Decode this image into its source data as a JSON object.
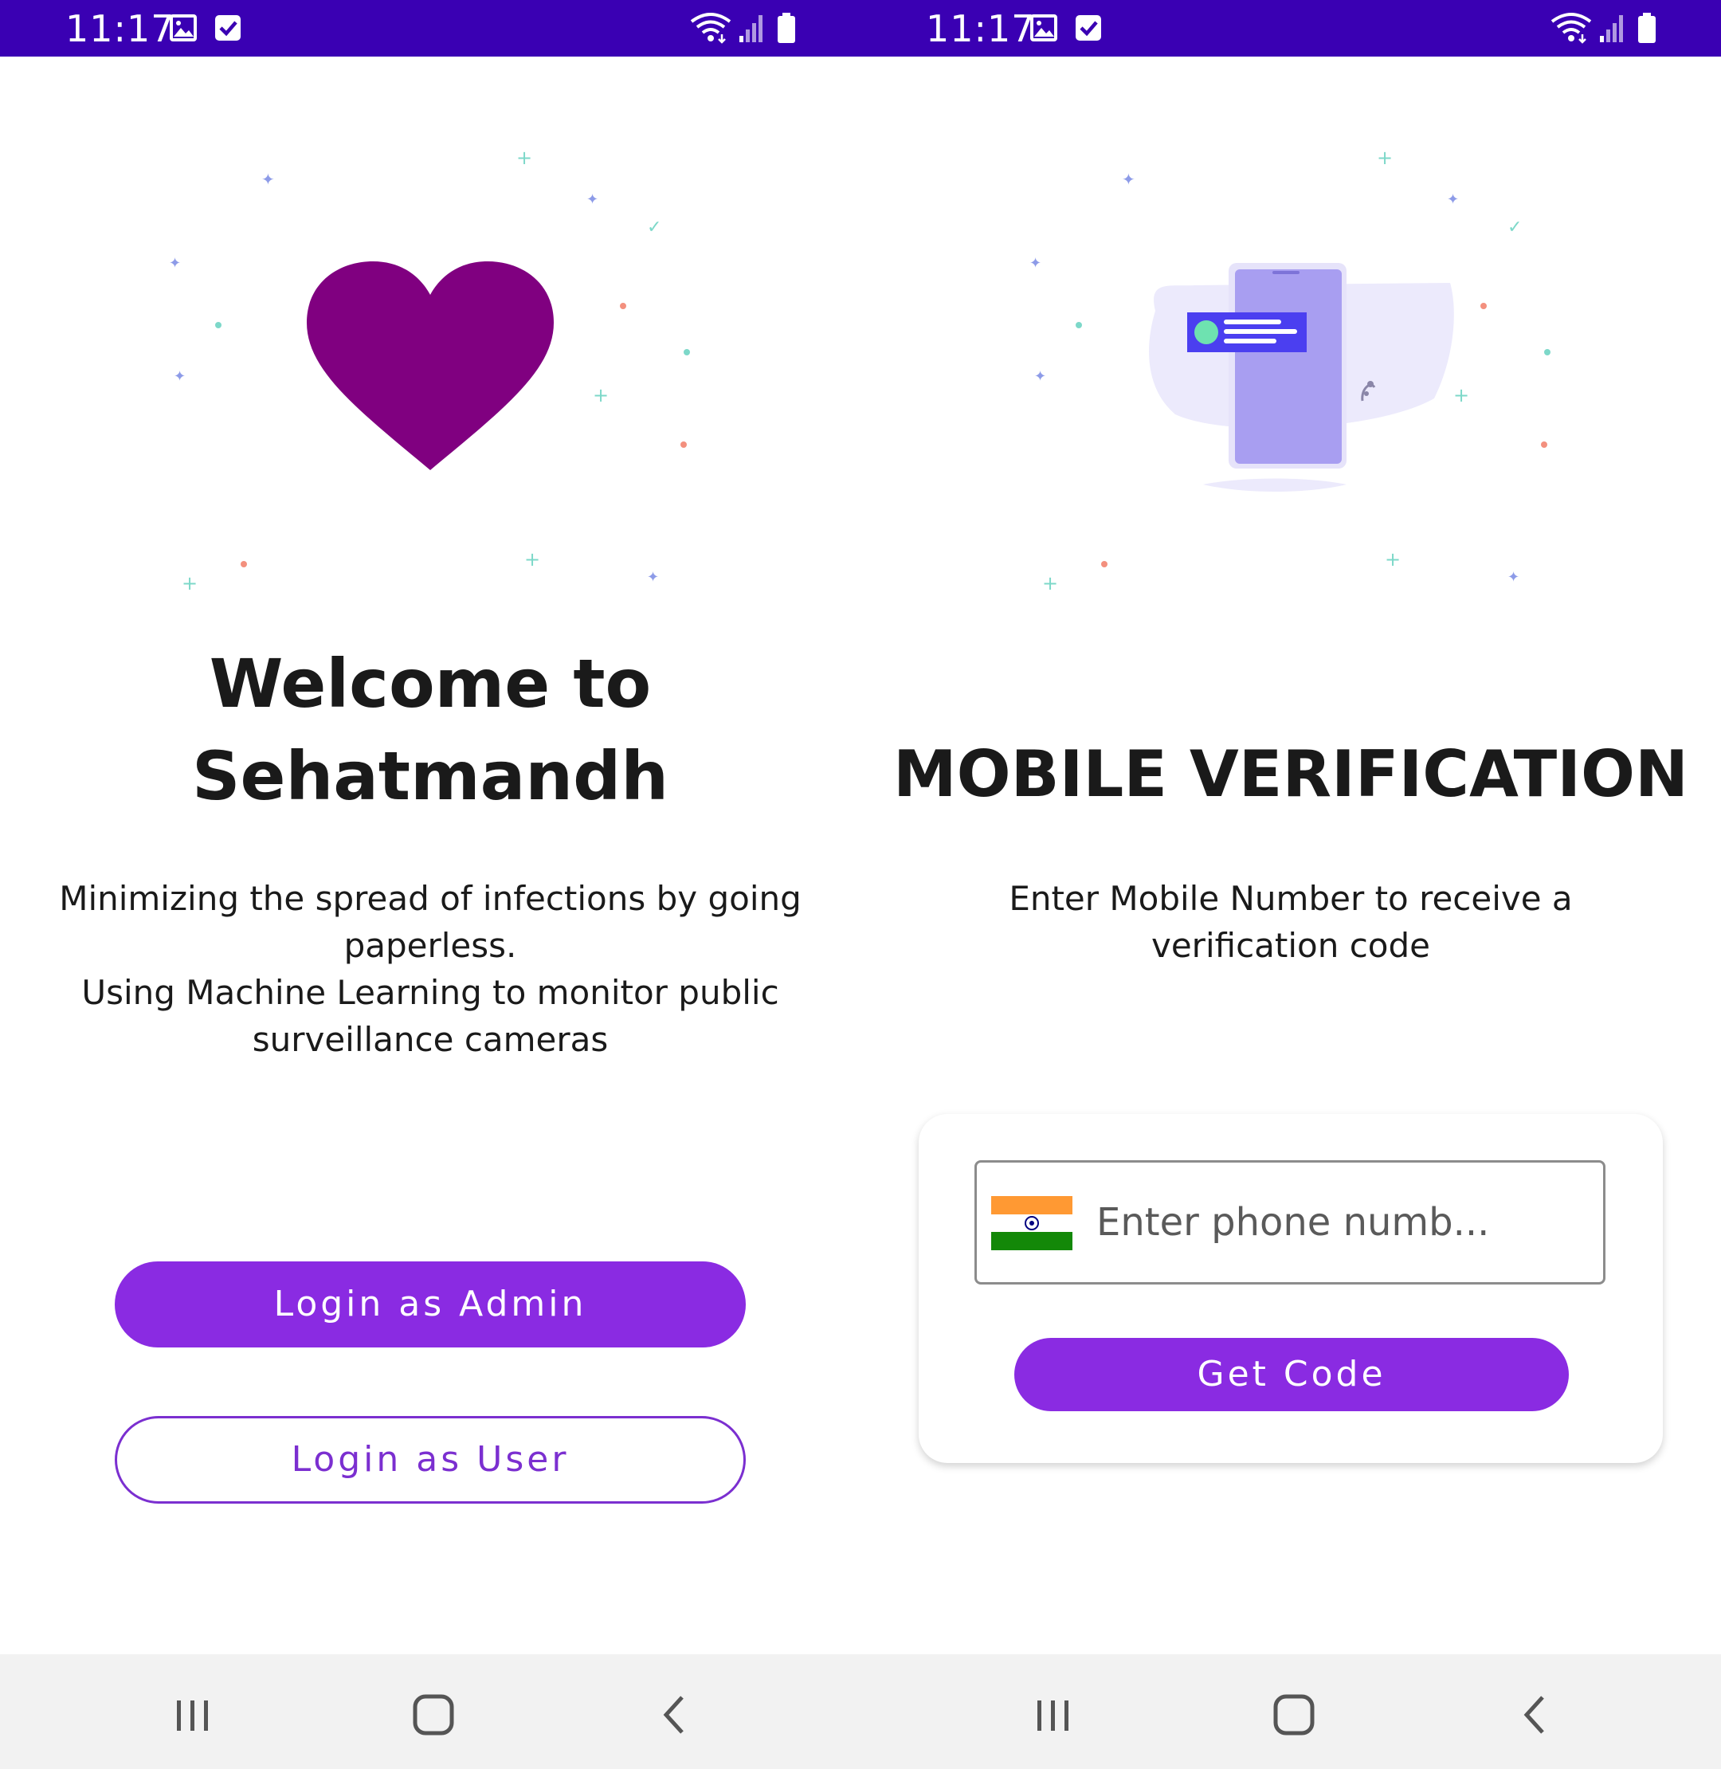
{
  "status_bar": {
    "time": "11:17"
  },
  "welcome_screen": {
    "title_line1": "Welcome to",
    "title_line2": "Sehatmandh",
    "description_line1": "Minimizing the spread of infections by going",
    "description_line2": "paperless.",
    "description_line3": "Using Machine Learning to monitor public",
    "description_line4": "surveillance cameras",
    "admin_button_label": "Login as Admin",
    "user_button_label": "Login as User"
  },
  "verification_screen": {
    "title": "MOBILE VERIFICATION",
    "description_line1": "Enter Mobile Number to receive a",
    "description_line2": "verification code",
    "phone_placeholder": "Enter phone numb...",
    "get_code_label": "Get Code"
  },
  "colors": {
    "status_bar": "#3a00b3",
    "primary_button": "#8a2be2",
    "outline_button": "#7b2fd0",
    "heart": "#800080"
  }
}
